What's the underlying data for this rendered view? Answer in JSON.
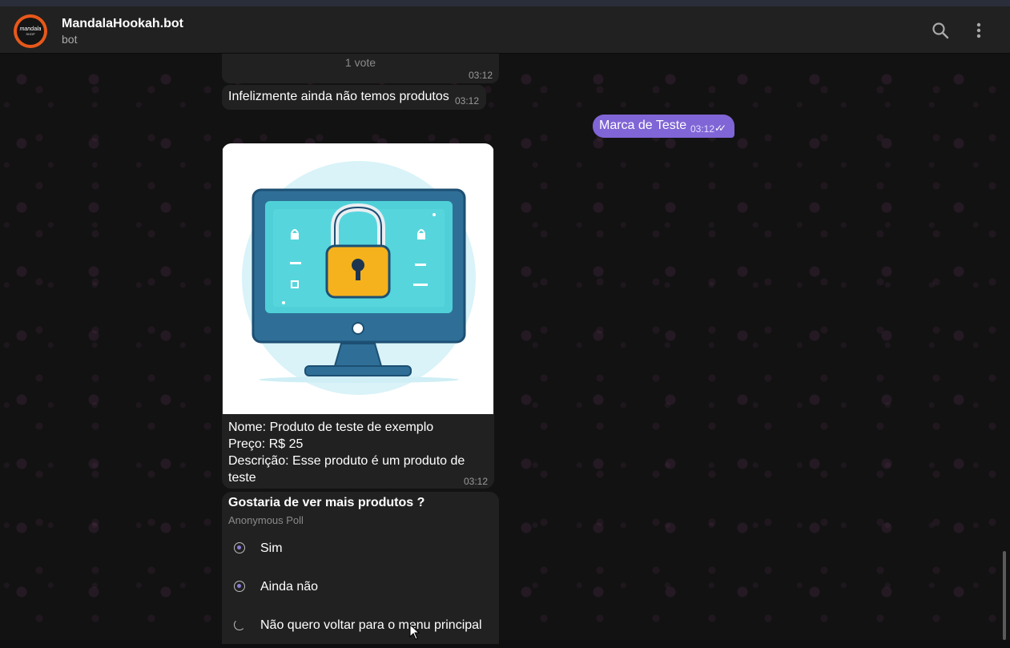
{
  "header": {
    "title": "MandalaHookah.bot",
    "subtitle": "bot",
    "avatar_text": "mandala",
    "avatar_subtext": "SHOP"
  },
  "messages": {
    "poll_top": {
      "votes": "1 vote",
      "time": "03:12"
    },
    "no_products": {
      "text": "Infelizmente ainda não temos produtos",
      "time": "03:12"
    },
    "outgoing": {
      "text": "Marca de Teste",
      "time": "03:12",
      "status": "read"
    },
    "product": {
      "caption": "Nome: Produto de teste de exemplo\nPreço: R$ 25\nDescrição: Esse produto é um produto de teste",
      "time": "03:12",
      "image": "computer-monitor-padlock-illustration"
    },
    "poll": {
      "question": "Gostaria de ver mais produtos ?",
      "kind": "Anonymous Poll",
      "options": [
        {
          "label": "Sim"
        },
        {
          "label": "Ainda não"
        },
        {
          "label": "Não quero voltar para o menu principal"
        }
      ]
    }
  },
  "colors": {
    "accent": "#8065d6",
    "avatar_ring": "#e8581a",
    "bubble": "#212121",
    "header": "#212121"
  },
  "icons": [
    "search-icon",
    "more-vertical-icon",
    "double-check-icon",
    "lock-icon"
  ]
}
